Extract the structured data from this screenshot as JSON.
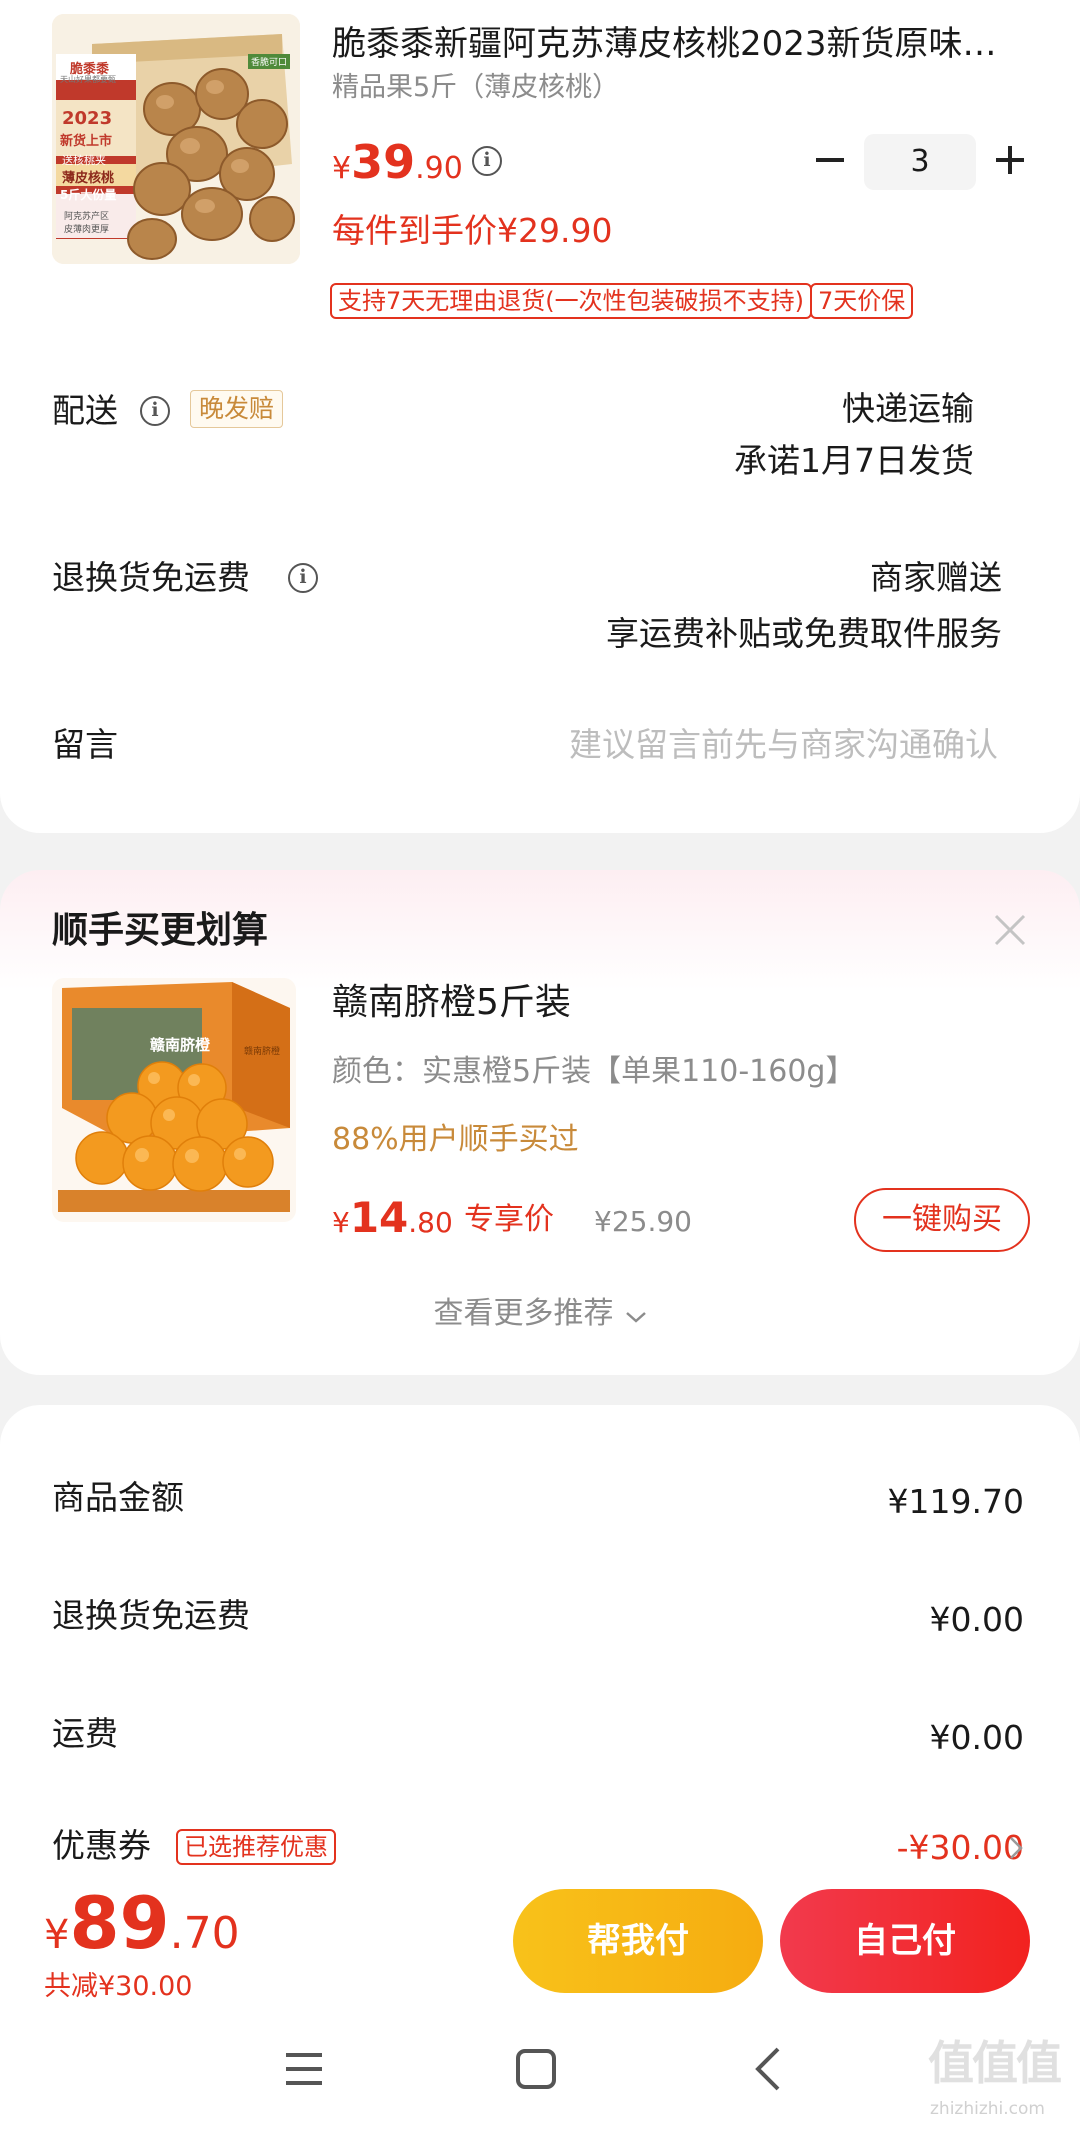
{
  "product": {
    "title": "脆黍黍新疆阿克苏薄皮核桃2023新货原味…",
    "spec": "精品果5斤（薄皮核桃）",
    "price_symbol": "¥",
    "price_int": "39",
    "price_dec": ".90",
    "quantity": "3",
    "final_price": "每件到手价¥29.90",
    "tags": [
      "支持7天无理由退货(一次性包装破损不支持)",
      "7天价保"
    ],
    "image_text": {
      "brand": "脆黍黍",
      "brand_sub": "天山好果都要甄",
      "badge_top": "2023",
      "badge_bottom": "新货上市",
      "line1": "送核桃夹",
      "line2": "薄皮核桃",
      "line3": "5斤大份量",
      "line4": "阿克苏产区",
      "line5": "皮薄肉更厚",
      "corner": "香脆可口"
    }
  },
  "shipping": {
    "label": "配送",
    "badge": "晚发赔",
    "method": "快递运输",
    "promise": "承诺1月7日发货"
  },
  "return_shipping": {
    "label": "退换货免运费",
    "value": "商家赠送",
    "desc": "享运费补贴或免费取件服务"
  },
  "message": {
    "label": "留言",
    "placeholder": "建议留言前先与商家沟通确认"
  },
  "reco": {
    "title": "顺手买更划算",
    "item_title": "赣南脐橙5斤装",
    "item_spec": "颜色：实惠橙5斤装【单果110-160g】",
    "item_social": "88%用户顺手买过",
    "price_symbol": "¥",
    "price_int": "14",
    "price_dec": ".80",
    "price_tag": "专享价",
    "orig_price": "¥25.90",
    "buy_button": "一键购买",
    "more": "查看更多推荐",
    "image_text": "赣南脐橙",
    "image_text_box": "赣南脐橙"
  },
  "summary": {
    "rows": [
      {
        "label": "商品金额",
        "value": "¥119.70"
      },
      {
        "label": "退换货免运费",
        "value": "¥0.00"
      },
      {
        "label": "运费",
        "value": "¥0.00"
      }
    ],
    "coupon_label": "优惠券",
    "coupon_badge": "已选推荐优惠",
    "coupon_value": "-¥30.00"
  },
  "footer": {
    "total_symbol": "¥",
    "total_int": "89",
    "total_dec": ".70",
    "discount": "共减¥30.00",
    "help_pay": "帮我付",
    "self_pay": "自己付"
  },
  "watermark": {
    "text": "值值值",
    "url": "zhizhizhi.com"
  },
  "colors": {
    "accent_red": "#e3321e",
    "gold": "#c88a3a",
    "help_pay_bg": "#f8b515",
    "self_pay_bg": "#f22e36"
  }
}
